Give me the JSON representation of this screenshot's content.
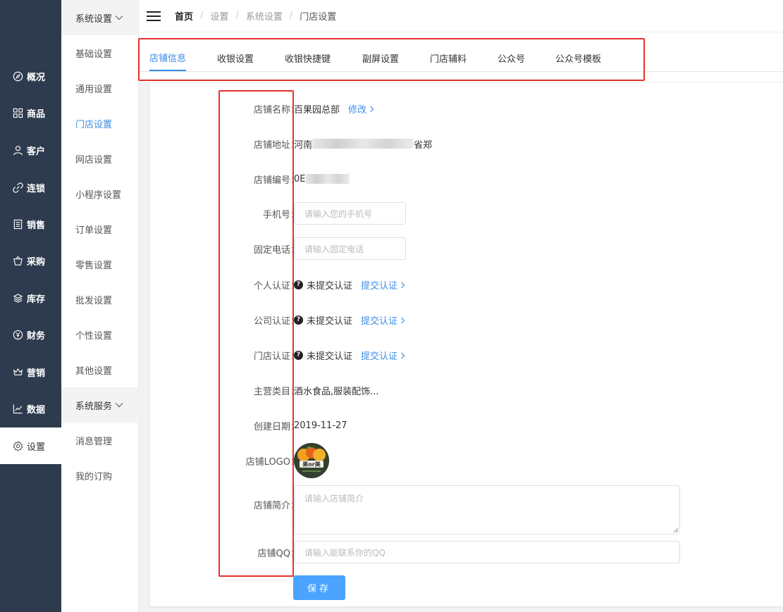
{
  "nav": {
    "items": [
      {
        "label": "概况",
        "icon": "compass-icon"
      },
      {
        "label": "商品",
        "icon": "grid-icon"
      },
      {
        "label": "客户",
        "icon": "user-icon"
      },
      {
        "label": "连锁",
        "icon": "link-icon"
      },
      {
        "label": "销售",
        "icon": "document-icon"
      },
      {
        "label": "采购",
        "icon": "purchase-icon"
      },
      {
        "label": "库存",
        "icon": "layers-icon"
      },
      {
        "label": "财务",
        "icon": "yen-icon"
      },
      {
        "label": "营销",
        "icon": "crown-icon"
      },
      {
        "label": "数据",
        "icon": "chart-icon"
      },
      {
        "label": "设置",
        "icon": "gear-icon"
      }
    ]
  },
  "sidebar": {
    "group1": "系统设置",
    "items1": [
      "基础设置",
      "通用设置",
      "门店设置",
      "网店设置",
      "小程序设置",
      "订单设置",
      "零售设置",
      "批发设置",
      "个性设置",
      "其他设置"
    ],
    "group2": "系统服务",
    "items2": [
      "消息管理",
      "我的订购"
    ]
  },
  "breadcrumb": [
    "首页",
    "设置",
    "系统设置",
    "门店设置"
  ],
  "tabs": [
    "店铺信息",
    "收银设置",
    "收银快捷键",
    "副屏设置",
    "门店辅料",
    "公众号",
    "公众号模板"
  ],
  "form": {
    "name_label": "店铺名称：",
    "name_value": "百果园总部",
    "edit_link": "修改",
    "address_label": "店铺地址：",
    "address_prefix": "河南",
    "address_suffix": "省郑",
    "code_label": "店铺编号：",
    "code_value": "0E",
    "phone_label": "手机号：",
    "phone_placeholder": "请输入您的手机号",
    "tel_label": "固定电话：",
    "tel_placeholder": "请输入固定电话",
    "personal_label": "个人认证：",
    "company_label": "公司认证：",
    "store_label": "门店认证：",
    "cert_status": "未提交认证",
    "cert_link": "提交认证",
    "category_label": "主营类目：",
    "category_value": "酒水食品,服装配饰...",
    "date_label": "创建日期：",
    "date_value": "2019-11-27",
    "logo_label": "店铺LOGO：",
    "logo_text": "果or美",
    "intro_label": "店铺简介：",
    "intro_placeholder": "请输入店铺简介",
    "qq_label": "店铺QQ：",
    "qq_placeholder": "请输入能联系你的QQ",
    "save": "保存"
  }
}
